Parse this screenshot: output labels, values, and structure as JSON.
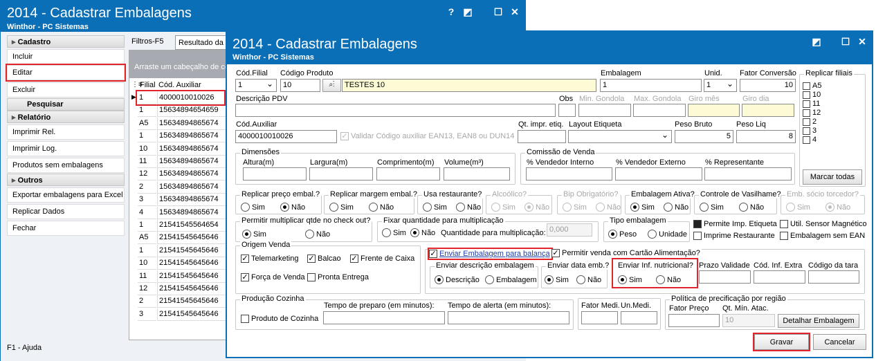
{
  "bg_window": {
    "title": "2014 - Cadastrar Embalagens",
    "subtitle": "Winthor - PC Sistemas",
    "controls": [
      "?",
      "◩",
      "☐",
      "✕"
    ]
  },
  "sidebar": {
    "cadastro": "Cadastro",
    "incluir": "Incluir",
    "editar": "Editar",
    "excluir": "Excluir",
    "pesquisar": "Pesquisar",
    "relatorio": "Relatório",
    "imprimir_rel": "Imprimir Rel.",
    "imprimir_log": "Imprimir Log.",
    "produtos_sem": "Produtos sem embalagens",
    "outros": "Outros",
    "exportar": "Exportar embalagens para Excel",
    "replicar": "Replicar Dados",
    "fechar": "Fechar"
  },
  "status": {
    "help": "F1 - Ajuda"
  },
  "grid": {
    "tab_filtros": "Filtros-F5",
    "tab_resultado": "Resultado da",
    "group_hint": "Arraste um cabeçalho de co",
    "col_filial": "Filial",
    "col_cod": "Cód. Auxiliar",
    "rows": [
      [
        "1",
        "4000010010026"
      ],
      [
        "1",
        "15634894654659"
      ],
      [
        "A5",
        "15634894865674"
      ],
      [
        "1",
        "15634894865674"
      ],
      [
        "10",
        "15634894865674"
      ],
      [
        "11",
        "15634894865674"
      ],
      [
        "12",
        "15634894865674"
      ],
      [
        "2",
        "15634894865674"
      ],
      [
        "3",
        "15634894865674"
      ],
      [
        "4",
        "15634894865674"
      ],
      [
        "1",
        "21541545564654"
      ],
      [
        "A5",
        "21541545645646"
      ],
      [
        "1",
        "21541545645646"
      ],
      [
        "10",
        "21541545645646"
      ],
      [
        "11",
        "21541545645646"
      ],
      [
        "12",
        "21541545645646"
      ],
      [
        "2",
        "21541545645646"
      ],
      [
        "3",
        "21541545645646"
      ]
    ]
  },
  "dialog": {
    "title": "2014 - Cadastrar Embalagens",
    "subtitle": "Winthor - PC Sistemas",
    "cod_filial_lbl": "Cód.Filial",
    "cod_filial": "1",
    "cod_produto_lbl": "Código Produto",
    "cod_produto": "10",
    "produto_desc": "TESTES 10",
    "embalagem_lbl": "Embalagem",
    "embalagem": "1",
    "unid_lbl": "Unid.",
    "unid": "1",
    "fator_lbl": "Fator Conversão",
    "fator": "10",
    "descricao_pdv_lbl": "Descrição PDV",
    "obs_lbl": "Obs",
    "min_gondola_lbl": "Min. Gondola",
    "max_gondola_lbl": "Max. Gondola",
    "giro_mes_lbl": "Giro mês",
    "giro_dia_lbl": "Giro dia",
    "cod_aux_lbl": "Cód.Auxiliar",
    "cod_aux": "4000010010026",
    "validar_lbl": "Validar Código auxiliar EAN13, EAN8 ou DUN14",
    "qt_impr_lbl": "Qt. impr. etiq.",
    "layout_lbl": "Layout Etiqueta",
    "peso_bruto_lbl": "Peso Bruto",
    "peso_bruto": "5",
    "peso_liq_lbl": "Peso Liq",
    "peso_liq": "8",
    "replicar_filiais_lbl": "Replicar filiais",
    "filiais": [
      "A5",
      "10",
      "11",
      "12",
      "2",
      "3",
      "4"
    ],
    "marcar_todas": "Marcar todas",
    "dimensoes_lbl": "Dimensões",
    "altura_lbl": "Altura(m)",
    "largura_lbl": "Largura(m)",
    "comprimento_lbl": "Comprimento(m)",
    "volume_lbl": "Volume(m³)",
    "comissao_lbl": "Comissão de Venda",
    "vend_int_lbl": "% Vendedor Interno",
    "vend_ext_lbl": "% Vendedor Externo",
    "repres_lbl": "% Representante",
    "sim": "Sim",
    "nao": "Não",
    "rep_preco_lbl": "Replicar preço embal.?",
    "rep_margem_lbl": "Replicar margem embal.?",
    "usa_rest_lbl": "Usa restaurante?",
    "alcoolico_lbl": "Alcoólico?",
    "bip_lbl": "Bip Obrigatório?",
    "emb_ativa_lbl": "Embalagem Ativa?",
    "vasilhame_lbl": "Controle de Vasilhame?",
    "socio_lbl": "Emb. sócio torcedor?",
    "permitir_mult_lbl": "Permitir multiplicar qtde no check out?",
    "fixar_qtd_lbl": "Fixar quantidade para multiplicação",
    "qtd_mult_lbl": "Quantidade para multiplicação:",
    "qtd_mult": "0,000",
    "tipo_emb_lbl": "Tipo embalagem",
    "peso_lbl": "Peso",
    "unidade_lbl": "Unidade",
    "permite_imp_lbl": "Permite Imp. Etiqueta",
    "util_sensor_lbl": "Util. Sensor Magnético",
    "imprime_rest_lbl": "Imprime Restaurante",
    "emb_sem_ean_lbl": "Embalagem sem EAN",
    "origem_lbl": "Origem Venda",
    "telemarketing": "Telemarketing",
    "balcao": "Balcao",
    "frente_caixa": "Frente de Caixa",
    "forca_venda": "Força de Venda",
    "pronta_entrega": "Pronta Entrega",
    "enviar_balanca": "Enviar Embalagem para balança",
    "permitir_cartao": "Permitir venda com Cartão Alimentação?",
    "env_desc_lbl": "Enviar descrição embalagem",
    "descricao_opt": "Descrição",
    "embalagem_opt": "Embalagem",
    "env_data_lbl": "Enviar data emb.?",
    "env_inf_lbl": "Enviar Inf. nutricional?",
    "prazo_val_lbl": "Prazo Validade",
    "cod_inf_extra_lbl": "Cód. Inf. Extra",
    "cod_tara_lbl": "Código da tara",
    "prod_cozinha_lbl": "Produção Cozinha",
    "produto_cozinha": "Produto de Cozinha",
    "tempo_preparo_lbl": "Tempo de preparo (em minutos):",
    "tempo_alerta_lbl": "Tempo de alerta (em minutos):",
    "fator_medi_lbl": "Fator Medi.",
    "un_medi_lbl": "Un.Medi.",
    "politica_lbl": "Política de precificação por região",
    "fator_preco_lbl": "Fator Preço",
    "qt_min_atac_lbl": "Qt. Mín. Atac.",
    "qt_min_atac": "10",
    "detalhar_btn": "Detalhar Embalagem",
    "gravar": "Gravar",
    "cancelar": "Cancelar"
  }
}
